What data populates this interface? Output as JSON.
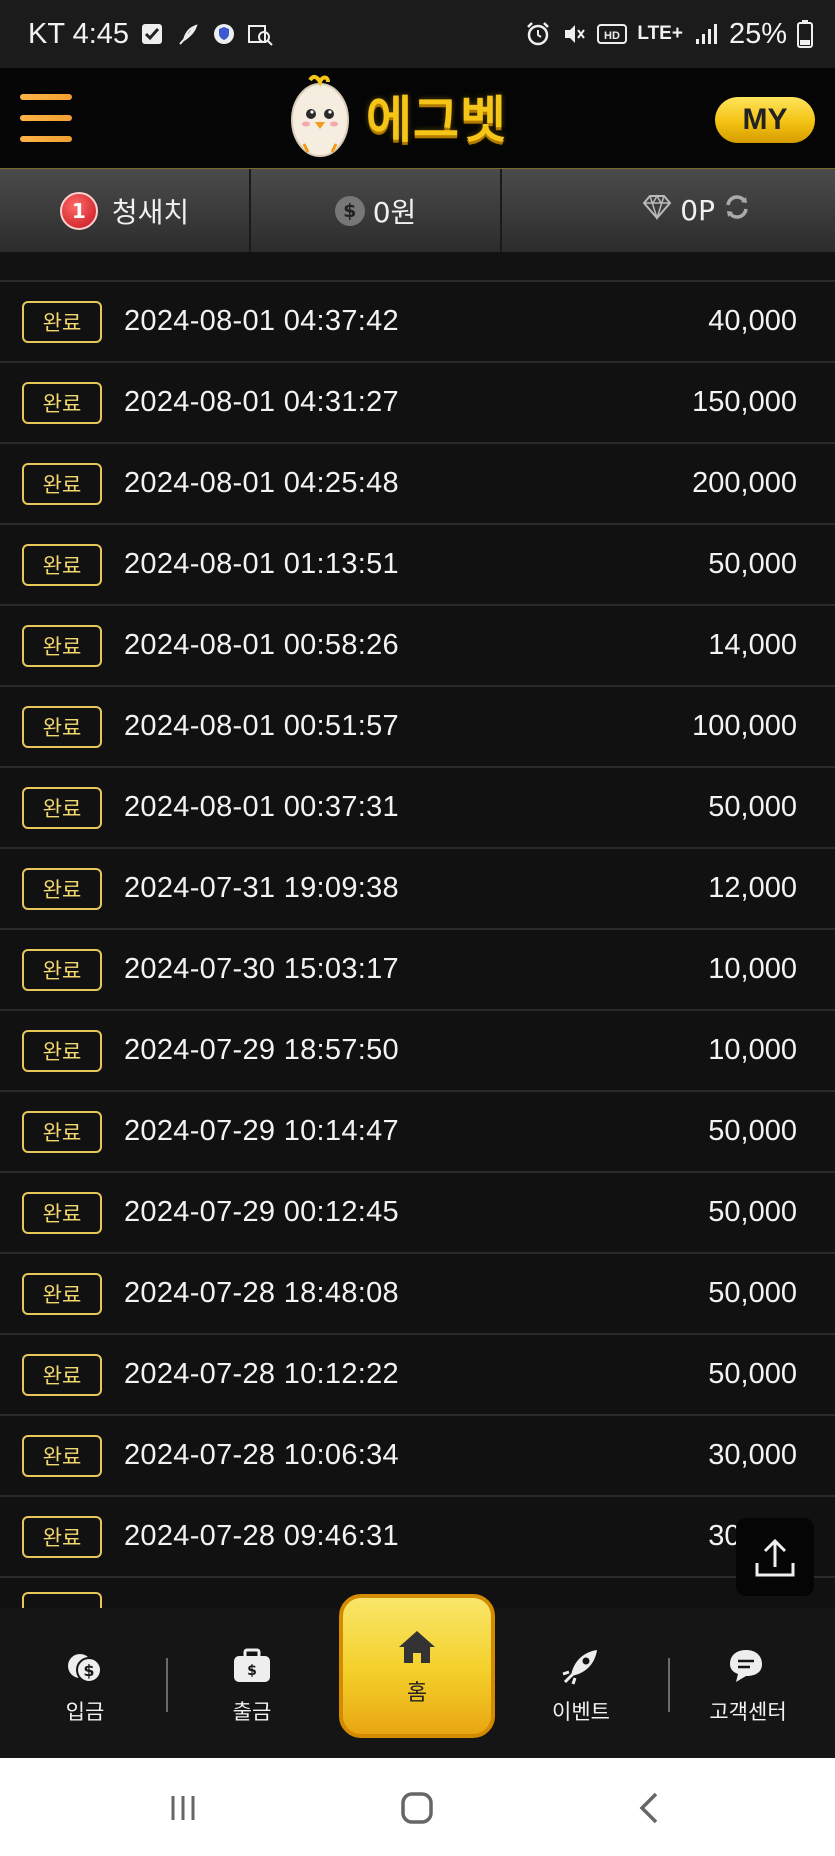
{
  "status_bar": {
    "carrier_time": "KT 4:45",
    "battery": "25%",
    "network": "LTE+"
  },
  "header": {
    "logo_text": "에그벳",
    "my_label": "MY"
  },
  "info_bar": {
    "level": "1",
    "user_name": "청새치",
    "money": "0원",
    "points": "0P"
  },
  "transactions": [
    {
      "status": "완료",
      "datetime": "2024-08-01 04:37:42",
      "amount": "40,000"
    },
    {
      "status": "완료",
      "datetime": "2024-08-01 04:31:27",
      "amount": "150,000"
    },
    {
      "status": "완료",
      "datetime": "2024-08-01 04:25:48",
      "amount": "200,000"
    },
    {
      "status": "완료",
      "datetime": "2024-08-01 01:13:51",
      "amount": "50,000"
    },
    {
      "status": "완료",
      "datetime": "2024-08-01 00:58:26",
      "amount": "14,000"
    },
    {
      "status": "완료",
      "datetime": "2024-08-01 00:51:57",
      "amount": "100,000"
    },
    {
      "status": "완료",
      "datetime": "2024-08-01 00:37:31",
      "amount": "50,000"
    },
    {
      "status": "완료",
      "datetime": "2024-07-31 19:09:38",
      "amount": "12,000"
    },
    {
      "status": "완료",
      "datetime": "2024-07-30 15:03:17",
      "amount": "10,000"
    },
    {
      "status": "완료",
      "datetime": "2024-07-29 18:57:50",
      "amount": "10,000"
    },
    {
      "status": "완료",
      "datetime": "2024-07-29 10:14:47",
      "amount": "50,000"
    },
    {
      "status": "완료",
      "datetime": "2024-07-29 00:12:45",
      "amount": "50,000"
    },
    {
      "status": "완료",
      "datetime": "2024-07-28 18:48:08",
      "amount": "50,000"
    },
    {
      "status": "완료",
      "datetime": "2024-07-28 10:12:22",
      "amount": "50,000"
    },
    {
      "status": "완료",
      "datetime": "2024-07-28 10:06:34",
      "amount": "30,000"
    },
    {
      "status": "완료",
      "datetime": "2024-07-28 09:46:31",
      "amount": "30,000"
    }
  ],
  "bottom_nav": {
    "deposit": "입금",
    "withdraw": "출금",
    "home": "홈",
    "event": "이벤트",
    "support": "고객센터"
  },
  "colors": {
    "accent_gold": "#f3c212",
    "badge_border": "#e7c65a",
    "background": "#111111"
  }
}
